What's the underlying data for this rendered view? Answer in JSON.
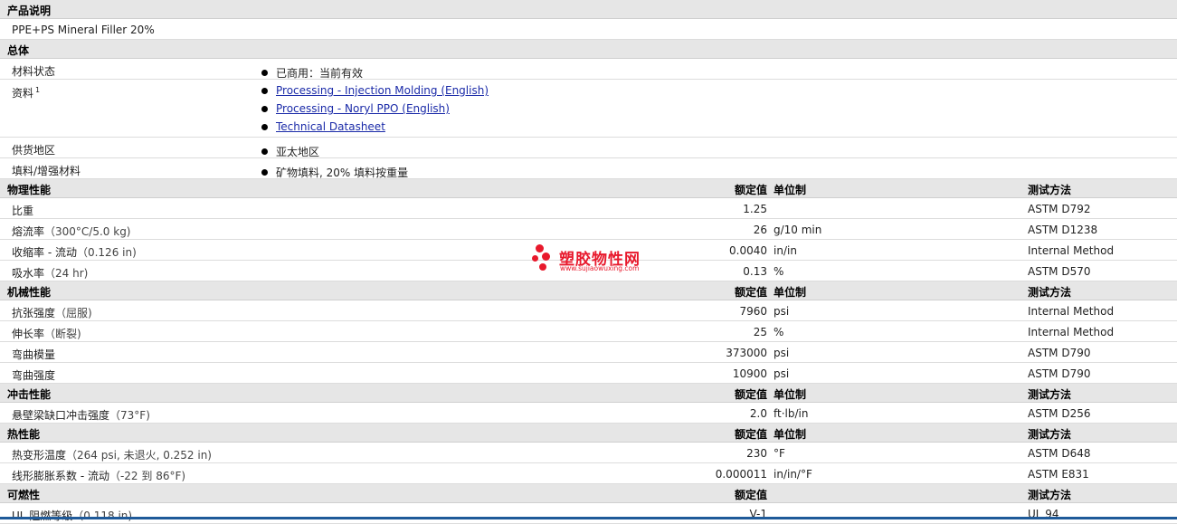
{
  "header_labels": {
    "value": "额定值",
    "unit": "单位制",
    "test": "测试方法"
  },
  "product_description": {
    "title": "产品说明",
    "text": "PPE+PS Mineral Filler 20%"
  },
  "general": {
    "title": "总体",
    "material_status": {
      "label": "材料状态",
      "value": "已商用：当前有效"
    },
    "documents": {
      "label": "资料",
      "footnote": "1",
      "links": [
        "Processing - Injection Molding (English)",
        "Processing - Noryl PPO (English)",
        "Technical Datasheet"
      ]
    },
    "availability": {
      "label": "供货地区",
      "value": "亚太地区"
    },
    "filler": {
      "label": "填料/增强材料",
      "value": "矿物填料, 20% 填料按重量"
    }
  },
  "physical": {
    "title": "物理性能",
    "rows": [
      {
        "label": "比重",
        "cond": "",
        "value": "1.25",
        "unit": "",
        "test": "ASTM D792"
      },
      {
        "label": "熔流率",
        "cond": "（300°C/5.0 kg)",
        "value": "26",
        "unit": "g/10 min",
        "test": "ASTM D1238"
      },
      {
        "label": "收缩率 - 流动",
        "cond": "（0.126 in)",
        "value": "0.0040",
        "unit": "in/in",
        "test": "Internal Method"
      },
      {
        "label": "吸水率",
        "cond": "（24 hr)",
        "value": "0.13",
        "unit": "%",
        "test": "ASTM D570"
      }
    ]
  },
  "mechanical": {
    "title": "机械性能",
    "rows": [
      {
        "label": "抗张强度",
        "cond": "（屈服)",
        "value": "7960",
        "unit": "psi",
        "test": "Internal Method"
      },
      {
        "label": "伸长率",
        "cond": "（断裂)",
        "value": "25",
        "unit": "%",
        "test": "Internal Method"
      },
      {
        "label": "弯曲模量",
        "cond": "",
        "value": "373000",
        "unit": "psi",
        "test": "ASTM D790"
      },
      {
        "label": "弯曲强度",
        "cond": "",
        "value": "10900",
        "unit": "psi",
        "test": "ASTM D790"
      }
    ]
  },
  "impact": {
    "title": "冲击性能",
    "rows": [
      {
        "label": "悬壁梁缺口冲击强度",
        "cond": "（73°F)",
        "value": "2.0",
        "unit": "ft·lb/in",
        "test": "ASTM D256"
      }
    ]
  },
  "thermal": {
    "title": "热性能",
    "rows": [
      {
        "label": "热变形温度",
        "cond": "（264 psi, 未退火, 0.252 in)",
        "value": "230",
        "unit": "°F",
        "test": "ASTM D648"
      },
      {
        "label": "线形膨胀系数 - 流动",
        "cond": "（-22 到 86°F)",
        "value": "0.000011",
        "unit": "in/in/°F",
        "test": "ASTM E831"
      }
    ]
  },
  "flammability": {
    "title": "可燃性",
    "rows": [
      {
        "label": "UL 阻燃等级",
        "cond": "（0.118 in)",
        "value": "V-1",
        "unit": "",
        "test": "UL 94"
      }
    ]
  },
  "watermark": {
    "name": "塑胶物性网",
    "url": "www.sujiaowuxing.com",
    "color": "#e8192c"
  },
  "colors": {
    "header_bg": "#e6e6e6",
    "link": "#1a2aa8",
    "bottom_bar": "#1f5a99"
  }
}
